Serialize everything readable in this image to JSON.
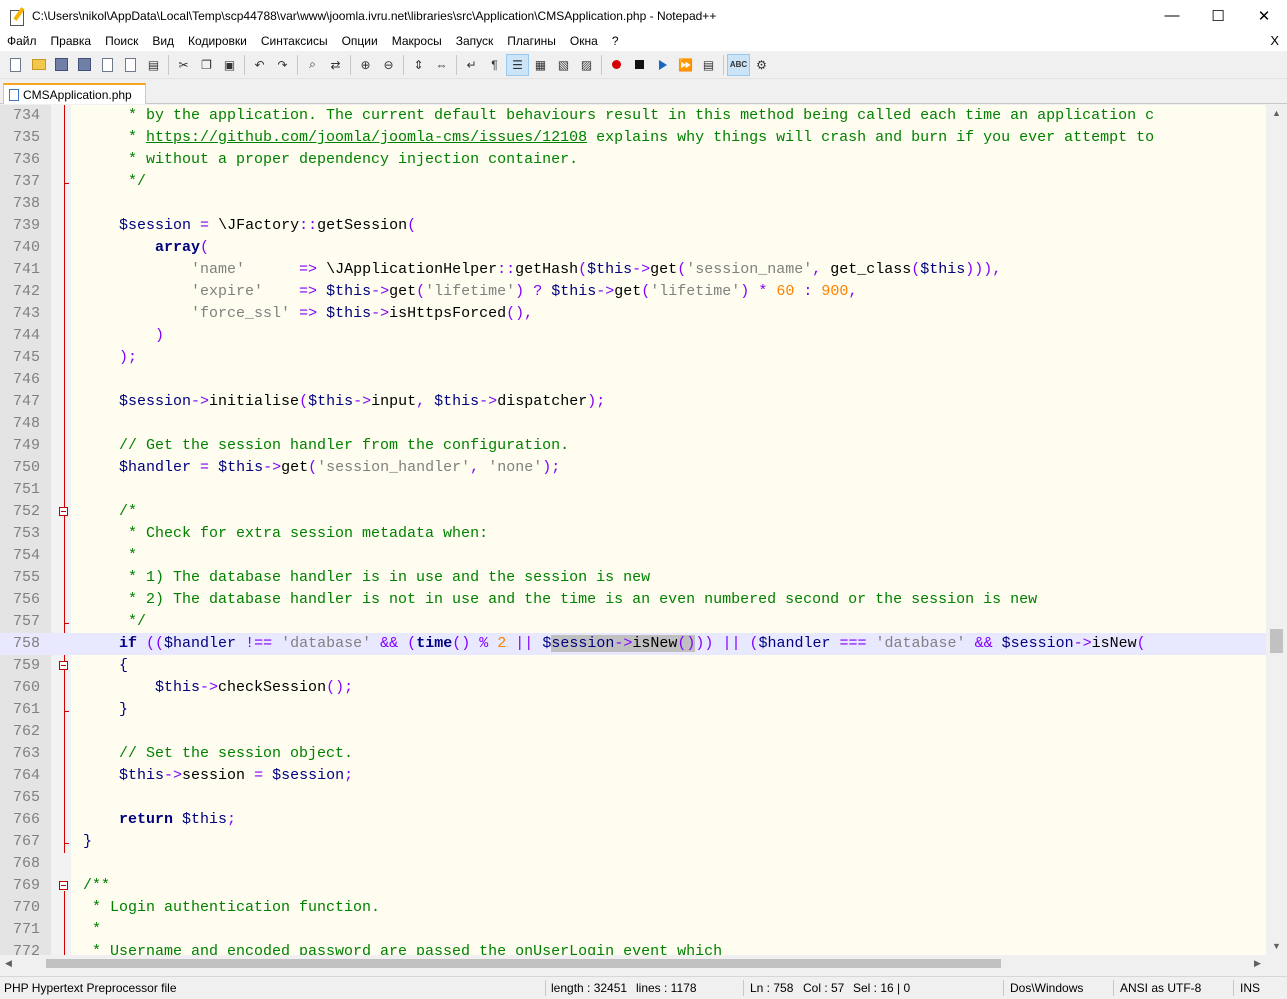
{
  "window": {
    "title": "C:\\Users\\nikol\\AppData\\Local\\Temp\\scp44788\\var\\www\\joomla.ivru.net\\libraries\\src\\Application\\CMSApplication.php - Notepad++",
    "minimize": "—",
    "maximize": "☐",
    "close": "✕"
  },
  "menu": {
    "file": "Файл",
    "edit": "Правка",
    "search": "Поиск",
    "view": "Вид",
    "encoding": "Кодировки",
    "syntax": "Синтаксисы",
    "options": "Опции",
    "macros": "Макросы",
    "run": "Запуск",
    "plugins": "Плагины",
    "window": "Окна",
    "help": "?",
    "close_doc": "X"
  },
  "tab": {
    "label": "CMSApplication.php"
  },
  "status": {
    "filetype": "PHP Hypertext Preprocessor file",
    "length": "length : 32451",
    "lines": "lines : 1178",
    "ln": "Ln : 758",
    "col": "Col : 57",
    "sel": "Sel : 16 | 0",
    "eol": "Dos\\Windows",
    "encoding": "ANSI as UTF-8",
    "mode": "INS"
  },
  "editor": {
    "current_line": 758,
    "lines": [
      {
        "n": "734",
        "fold": "",
        "segs": [
          [
            "c-com",
            "\t * by the application. The current default behaviours result in this method being called each time an application c"
          ]
        ]
      },
      {
        "n": "735",
        "fold": "",
        "segs": [
          [
            "c-com",
            "\t * "
          ],
          [
            "c-link",
            "https://github.com/joomla/joomla-cms/issues/12108"
          ],
          [
            "c-com",
            " explains why things will crash and burn if you ever attempt to"
          ]
        ]
      },
      {
        "n": "736",
        "fold": "",
        "segs": [
          [
            "c-com",
            "\t * without a proper dependency injection container."
          ]
        ]
      },
      {
        "n": "737",
        "fold": "end",
        "segs": [
          [
            "c-com",
            "\t */"
          ]
        ]
      },
      {
        "n": "738",
        "fold": "",
        "segs": []
      },
      {
        "n": "739",
        "fold": "",
        "segs": [
          [
            "c-var",
            "\t$session"
          ],
          [
            "c-def",
            " "
          ],
          [
            "c-op",
            "="
          ],
          [
            "c-def",
            " \\JFactory"
          ],
          [
            "c-op",
            "::"
          ],
          [
            "c-def",
            "getSession"
          ],
          [
            "c-op",
            "("
          ]
        ]
      },
      {
        "n": "740",
        "fold": "",
        "segs": [
          [
            "c-kw",
            "\t\tarray"
          ],
          [
            "c-op",
            "("
          ]
        ]
      },
      {
        "n": "741",
        "fold": "",
        "segs": [
          [
            "c-str",
            "\t\t\t'name'"
          ],
          [
            "c-def",
            "      "
          ],
          [
            "c-op",
            "=>"
          ],
          [
            "c-def",
            " \\JApplicationHelper"
          ],
          [
            "c-op",
            "::"
          ],
          [
            "c-def",
            "getHash"
          ],
          [
            "c-op",
            "("
          ],
          [
            "c-var",
            "$this"
          ],
          [
            "c-op",
            "->"
          ],
          [
            "c-def",
            "get"
          ],
          [
            "c-op",
            "("
          ],
          [
            "c-str",
            "'session_name'"
          ],
          [
            "c-op",
            ","
          ],
          [
            "c-def",
            " get_class"
          ],
          [
            "c-op",
            "("
          ],
          [
            "c-var",
            "$this"
          ],
          [
            "c-op",
            ")))"
          ],
          [
            "c-op",
            ","
          ]
        ]
      },
      {
        "n": "742",
        "fold": "",
        "segs": [
          [
            "c-str",
            "\t\t\t'expire'"
          ],
          [
            "c-def",
            "    "
          ],
          [
            "c-op",
            "=>"
          ],
          [
            "c-def",
            " "
          ],
          [
            "c-var",
            "$this"
          ],
          [
            "c-op",
            "->"
          ],
          [
            "c-def",
            "get"
          ],
          [
            "c-op",
            "("
          ],
          [
            "c-str",
            "'lifetime'"
          ],
          [
            "c-op",
            ")"
          ],
          [
            "c-def",
            " "
          ],
          [
            "c-op",
            "?"
          ],
          [
            "c-def",
            " "
          ],
          [
            "c-var",
            "$this"
          ],
          [
            "c-op",
            "->"
          ],
          [
            "c-def",
            "get"
          ],
          [
            "c-op",
            "("
          ],
          [
            "c-str",
            "'lifetime'"
          ],
          [
            "c-op",
            ")"
          ],
          [
            "c-def",
            " "
          ],
          [
            "c-op",
            "*"
          ],
          [
            "c-def",
            " "
          ],
          [
            "c-num",
            "60"
          ],
          [
            "c-def",
            " "
          ],
          [
            "c-op",
            ":"
          ],
          [
            "c-def",
            " "
          ],
          [
            "c-num",
            "900"
          ],
          [
            "c-op",
            ","
          ]
        ]
      },
      {
        "n": "743",
        "fold": "",
        "segs": [
          [
            "c-str",
            "\t\t\t'force_ssl'"
          ],
          [
            "c-def",
            " "
          ],
          [
            "c-op",
            "=>"
          ],
          [
            "c-def",
            " "
          ],
          [
            "c-var",
            "$this"
          ],
          [
            "c-op",
            "->"
          ],
          [
            "c-def",
            "isHttpsForced"
          ],
          [
            "c-op",
            "(),"
          ]
        ]
      },
      {
        "n": "744",
        "fold": "",
        "segs": [
          [
            "c-op",
            "\t\t)"
          ]
        ]
      },
      {
        "n": "745",
        "fold": "",
        "segs": [
          [
            "c-op",
            "\t);"
          ]
        ]
      },
      {
        "n": "746",
        "fold": "",
        "segs": []
      },
      {
        "n": "747",
        "fold": "",
        "segs": [
          [
            "c-var",
            "\t$session"
          ],
          [
            "c-op",
            "->"
          ],
          [
            "c-def",
            "initialise"
          ],
          [
            "c-op",
            "("
          ],
          [
            "c-var",
            "$this"
          ],
          [
            "c-op",
            "->"
          ],
          [
            "c-def",
            "input"
          ],
          [
            "c-op",
            ","
          ],
          [
            "c-def",
            " "
          ],
          [
            "c-var",
            "$this"
          ],
          [
            "c-op",
            "->"
          ],
          [
            "c-def",
            "dispatcher"
          ],
          [
            "c-op",
            ");"
          ]
        ]
      },
      {
        "n": "748",
        "fold": "",
        "segs": []
      },
      {
        "n": "749",
        "fold": "",
        "segs": [
          [
            "c-com",
            "\t// Get the session handler from the configuration."
          ]
        ]
      },
      {
        "n": "750",
        "fold": "",
        "segs": [
          [
            "c-var",
            "\t$handler"
          ],
          [
            "c-def",
            " "
          ],
          [
            "c-op",
            "="
          ],
          [
            "c-def",
            " "
          ],
          [
            "c-var",
            "$this"
          ],
          [
            "c-op",
            "->"
          ],
          [
            "c-def",
            "get"
          ],
          [
            "c-op",
            "("
          ],
          [
            "c-str",
            "'session_handler'"
          ],
          [
            "c-op",
            ","
          ],
          [
            "c-def",
            " "
          ],
          [
            "c-str",
            "'none'"
          ],
          [
            "c-op",
            ");"
          ]
        ]
      },
      {
        "n": "751",
        "fold": "",
        "segs": []
      },
      {
        "n": "752",
        "fold": "open",
        "segs": [
          [
            "c-com",
            "\t/*"
          ]
        ]
      },
      {
        "n": "753",
        "fold": "",
        "segs": [
          [
            "c-com",
            "\t * Check for extra session metadata when:"
          ]
        ]
      },
      {
        "n": "754",
        "fold": "",
        "segs": [
          [
            "c-com",
            "\t *"
          ]
        ]
      },
      {
        "n": "755",
        "fold": "",
        "segs": [
          [
            "c-com",
            "\t * 1) The database handler is in use and the session is new"
          ]
        ]
      },
      {
        "n": "756",
        "fold": "",
        "segs": [
          [
            "c-com",
            "\t * 2) The database handler is not in use and the time is an even numbered second or the session is new"
          ]
        ]
      },
      {
        "n": "757",
        "fold": "end",
        "segs": [
          [
            "c-com",
            "\t */"
          ]
        ]
      },
      {
        "n": "758",
        "fold": "",
        "segs": [
          [
            "c-kw",
            "\tif"
          ],
          [
            "c-def",
            " "
          ],
          [
            "c-op",
            "(("
          ],
          [
            "c-var",
            "$handler"
          ],
          [
            "c-def",
            " "
          ],
          [
            "c-op",
            "!=="
          ],
          [
            "c-def",
            " "
          ],
          [
            "c-str",
            "'database'"
          ],
          [
            "c-def",
            " "
          ],
          [
            "c-op",
            "&&"
          ],
          [
            "c-def",
            " "
          ],
          [
            "c-op",
            "("
          ],
          [
            "c-kw",
            "time"
          ],
          [
            "c-op",
            "()"
          ],
          [
            "c-def",
            " "
          ],
          [
            "c-op",
            "%"
          ],
          [
            "c-def",
            " "
          ],
          [
            "c-num",
            "2"
          ],
          [
            "c-def",
            " "
          ],
          [
            "c-op",
            "||"
          ],
          [
            "c-def",
            " "
          ],
          [
            "c-var",
            "$"
          ],
          [
            "c-sel c-var",
            "session"
          ],
          [
            "c-sel c-op",
            "->"
          ],
          [
            "c-sel c-def",
            "isNew"
          ],
          [
            "c-sel c-op",
            "()"
          ],
          [
            "c-op",
            "))"
          ],
          [
            "c-def",
            " "
          ],
          [
            "c-op",
            "||"
          ],
          [
            "c-def",
            " "
          ],
          [
            "c-op",
            "("
          ],
          [
            "c-var",
            "$handler"
          ],
          [
            "c-def",
            " "
          ],
          [
            "c-op",
            "==="
          ],
          [
            "c-def",
            " "
          ],
          [
            "c-str",
            "'database'"
          ],
          [
            "c-def",
            " "
          ],
          [
            "c-op",
            "&&"
          ],
          [
            "c-def",
            " "
          ],
          [
            "c-var",
            "$session"
          ],
          [
            "c-op",
            "->"
          ],
          [
            "c-def",
            "isNew"
          ],
          [
            "c-op",
            "("
          ]
        ]
      },
      {
        "n": "759",
        "fold": "open",
        "segs": [
          [
            "c-brace",
            "\t{"
          ]
        ]
      },
      {
        "n": "760",
        "fold": "",
        "segs": [
          [
            "c-var",
            "\t\t$this"
          ],
          [
            "c-op",
            "->"
          ],
          [
            "c-def",
            "checkSession"
          ],
          [
            "c-op",
            "();"
          ]
        ]
      },
      {
        "n": "761",
        "fold": "end",
        "segs": [
          [
            "c-brace",
            "\t}"
          ]
        ]
      },
      {
        "n": "762",
        "fold": "",
        "segs": []
      },
      {
        "n": "763",
        "fold": "",
        "segs": [
          [
            "c-com",
            "\t// Set the session object."
          ]
        ]
      },
      {
        "n": "764",
        "fold": "",
        "segs": [
          [
            "c-var",
            "\t$this"
          ],
          [
            "c-op",
            "->"
          ],
          [
            "c-def",
            "session"
          ],
          [
            "c-def",
            " "
          ],
          [
            "c-op",
            "="
          ],
          [
            "c-def",
            " "
          ],
          [
            "c-var",
            "$session"
          ],
          [
            "c-op",
            ";"
          ]
        ]
      },
      {
        "n": "765",
        "fold": "",
        "segs": []
      },
      {
        "n": "766",
        "fold": "",
        "segs": [
          [
            "c-kw",
            "\treturn"
          ],
          [
            "c-def",
            " "
          ],
          [
            "c-var",
            "$this"
          ],
          [
            "c-op",
            ";"
          ]
        ]
      },
      {
        "n": "767",
        "fold": "end",
        "segs": [
          [
            "c-brace",
            "}"
          ]
        ]
      },
      {
        "n": "768",
        "fold": "",
        "segs": []
      },
      {
        "n": "769",
        "fold": "open",
        "segs": [
          [
            "c-com",
            "/**"
          ]
        ]
      },
      {
        "n": "770",
        "fold": "",
        "segs": [
          [
            "c-com",
            " * Login authentication function."
          ]
        ]
      },
      {
        "n": "771",
        "fold": "",
        "segs": [
          [
            "c-com",
            " *"
          ]
        ]
      },
      {
        "n": "772",
        "fold": "",
        "segs": [
          [
            "c-com",
            " * Username and encoded password are passed the onUserLogin event which"
          ]
        ]
      }
    ]
  }
}
